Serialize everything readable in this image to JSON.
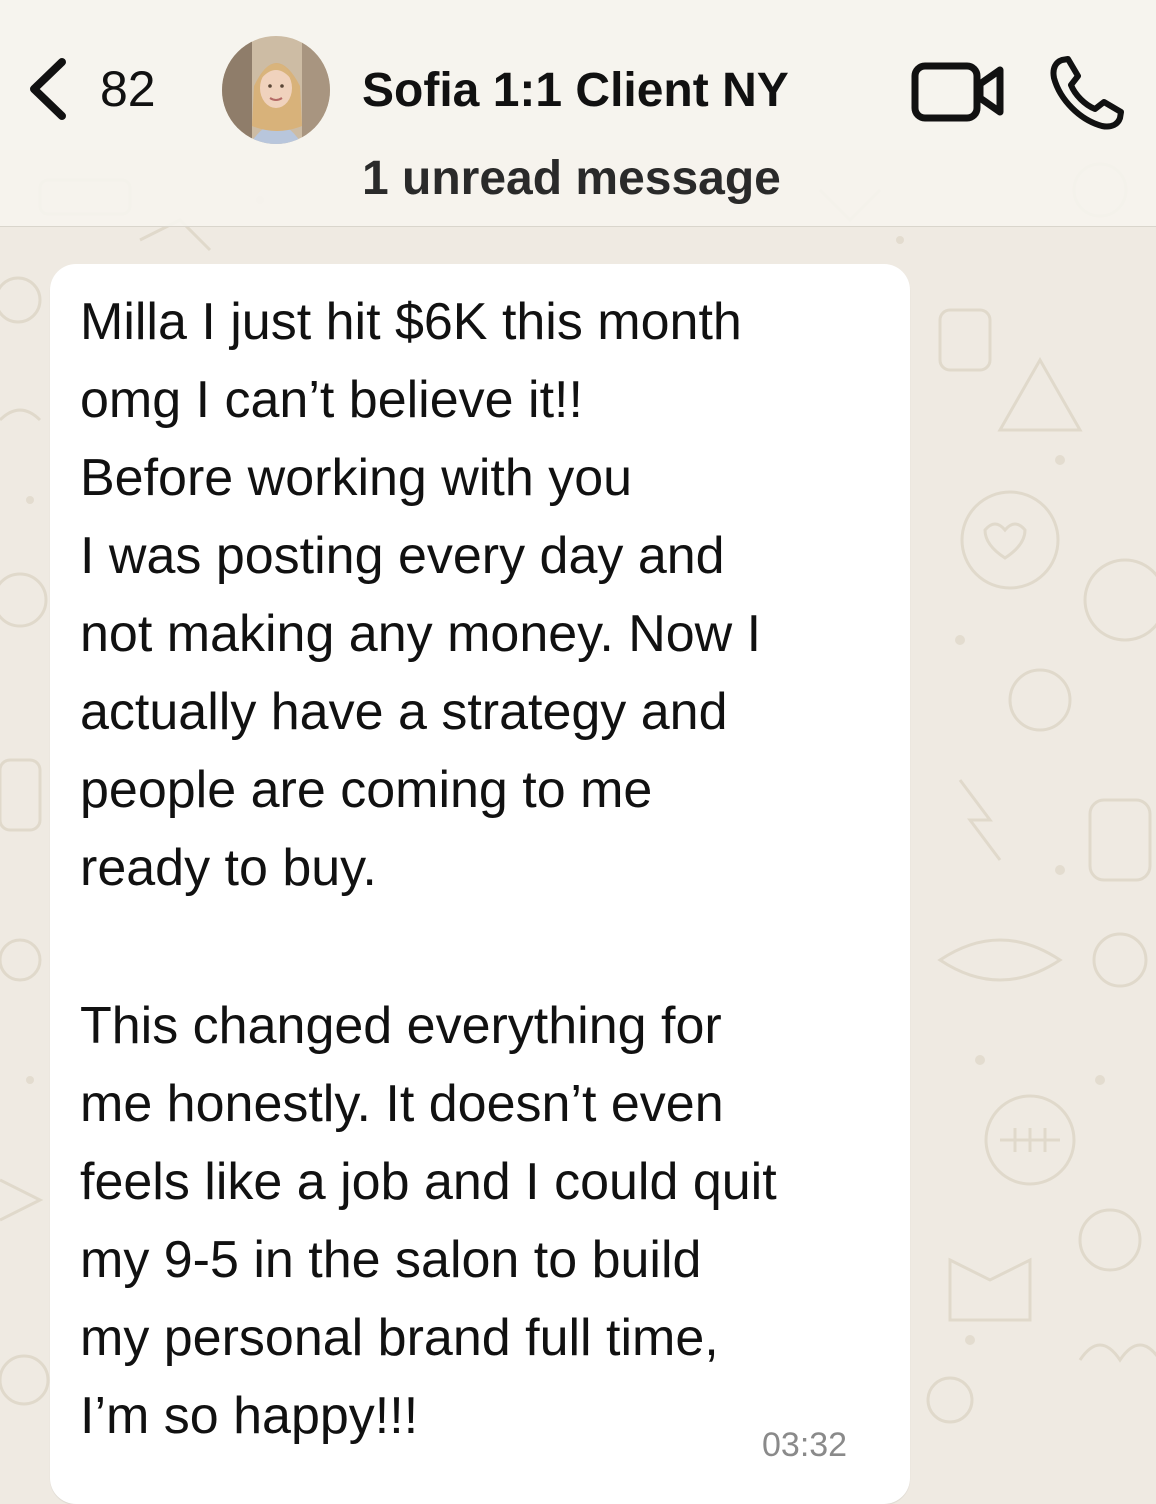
{
  "header": {
    "back_count": "82",
    "contact_name": "Sofia 1:1 Client NY",
    "unread_label": "1 unread message"
  },
  "message": {
    "lines": [
      "Milla I just hit $6K this month",
      "omg I can’t believe it!!",
      "Before working with you",
      "I was posting every day and",
      "not making any money. Now I",
      "actually have a strategy and",
      "people are coming to me",
      "ready to buy.",
      "This changed everything for",
      "me honestly. It doesn’t even",
      "feels like a job and I could quit",
      "my 9-5 in the salon to build",
      "my personal brand full time,",
      "I’m so happy!!!"
    ],
    "time": "03:32"
  },
  "icons": {
    "back": "chevron-left-icon",
    "video": "video-camera-icon",
    "phone": "phone-icon"
  },
  "colors": {
    "wallpaper": "#efeae2",
    "bubble": "#ffffff",
    "header": "#f6f4ee",
    "timestamp": "#8a8a8a"
  }
}
